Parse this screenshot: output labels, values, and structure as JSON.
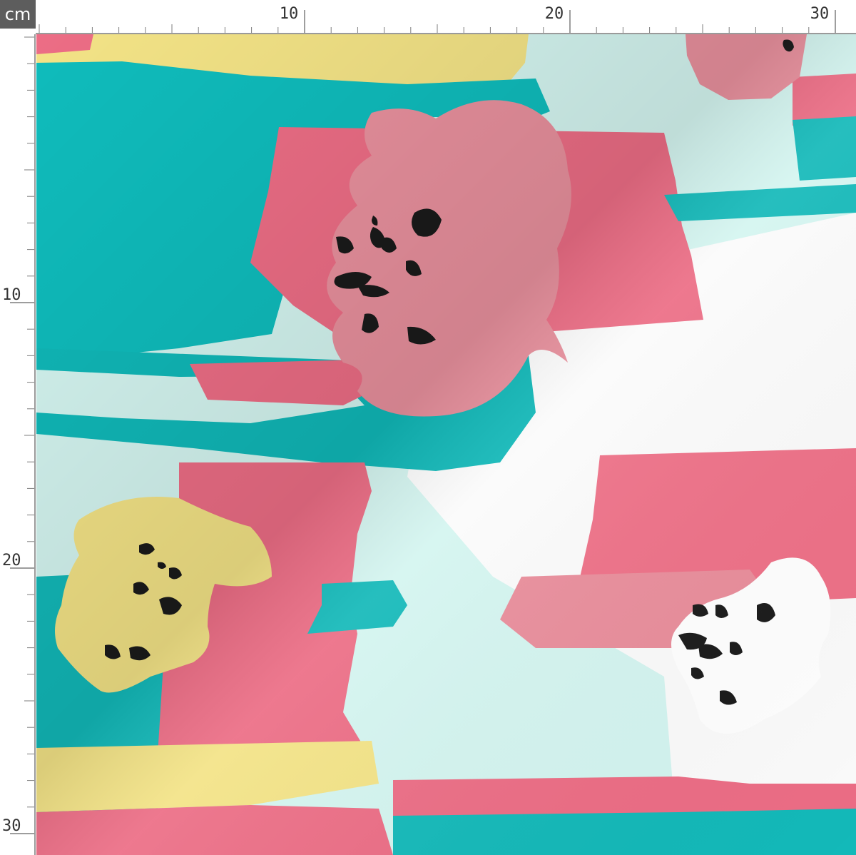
{
  "ruler": {
    "unit": "cm",
    "top_labels": [
      "10",
      "20",
      "30"
    ],
    "left_labels": [
      "10",
      "20",
      "30"
    ],
    "major_step_cm": 10,
    "tick_color": "#7d7d7d",
    "label_color": "#333333"
  },
  "fabric": {
    "colors": {
      "background_mint": "#d4f5f0",
      "teal": "#13b9b9",
      "pink": "#ec6d85",
      "dusty_pink": "#e8909d",
      "yellow": "#f3e386",
      "white": "#ffffff",
      "black": "#1a1a1a"
    }
  }
}
